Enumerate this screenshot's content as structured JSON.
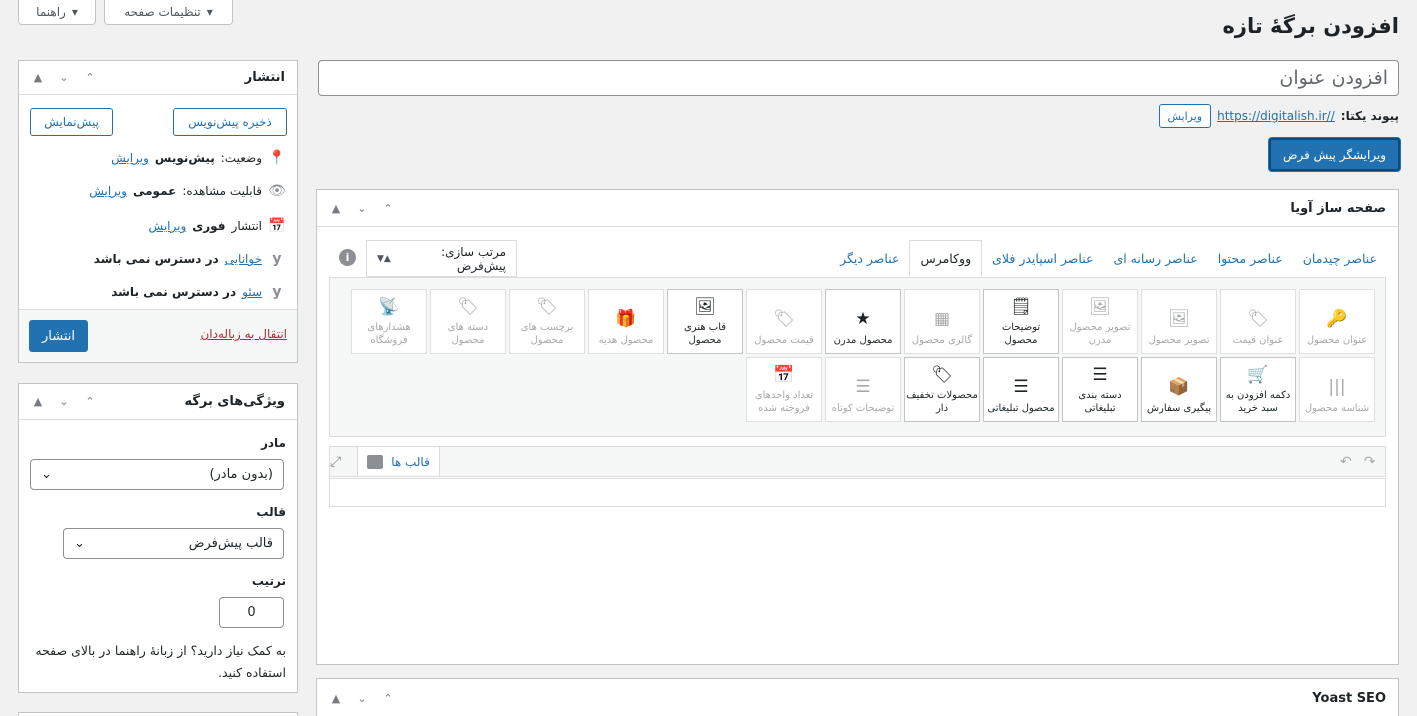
{
  "top": {
    "page_options": "تنظیمات صفحه",
    "help": "راهنما"
  },
  "page_title": "افزودن برگهٔ تازه",
  "title_placeholder": "افزودن عنوان",
  "permalink": {
    "label": "پیوند یکتا:",
    "url": "https://digitalish.ir//",
    "edit": "ویرایش"
  },
  "default_editor_button": "ویرایشگر پیش فرض",
  "builder": {
    "title": "صفحه ساز آویا",
    "tabs": [
      "عناصر چیدمان",
      "عناصر محتوا",
      "عناصر رسانه ای",
      "عناصر اسپایدر فلای",
      "ووکامرس",
      "عناصر دیگر"
    ],
    "active_tab": "ووکامرس",
    "sort_select": "مرتب سازی: پیش‌فرض",
    "row1": [
      {
        "label": "عنوان محصول",
        "icon": "🔑",
        "active": false
      },
      {
        "label": "عنوان قیمت",
        "icon": "🏷",
        "active": false
      },
      {
        "label": "تصویر محصول",
        "icon": "🖼",
        "active": false
      },
      {
        "label": "تصویر محصول مدرن",
        "icon": "🖼",
        "active": false
      },
      {
        "label": "توضیحات محصول",
        "icon": "🗒",
        "active": true
      },
      {
        "label": "گالری محصول",
        "icon": "▦",
        "active": false
      },
      {
        "label": "محصول مدرن",
        "icon": "★",
        "active": true
      },
      {
        "label": "قیمت محصول",
        "icon": "🏷",
        "active": false
      },
      {
        "label": "قاب هنری محصول",
        "icon": "🖼",
        "active": true
      },
      {
        "label": "محصول هدیه",
        "icon": "🎁",
        "active": false
      },
      {
        "label": "برچسب های محصول",
        "icon": "🏷",
        "active": false
      },
      {
        "label": "دسته های محصول",
        "icon": "🏷",
        "active": false
      },
      {
        "label": "هشدارهای فروشگاه",
        "icon": "📡",
        "active": false
      }
    ],
    "row2": [
      {
        "label": "شناسه محصول",
        "icon": "|||",
        "active": false
      },
      {
        "label": "دکمه افزودن به سبد خرید",
        "icon": "🛒",
        "active": true
      },
      {
        "label": "پیگیری سفارش",
        "icon": "📦",
        "active": true
      },
      {
        "label": "دسته بندی تبلیغاتی",
        "icon": "☰",
        "active": true
      },
      {
        "label": "محصول تبلیغاتی",
        "icon": "☰",
        "active": true
      },
      {
        "label": "محصولات تخفیف دار",
        "icon": "🏷",
        "active": true
      },
      {
        "label": "توضیحات کوتاه",
        "icon": "☰",
        "active": false
      },
      {
        "label": "تعداد واحدهای فروخته شده",
        "icon": "📅",
        "active": false
      }
    ],
    "templates": "قالب ها"
  },
  "yoast": {
    "title": "Yoast SEO"
  },
  "publish": {
    "title": "انتشار",
    "save_draft": "ذخیره پیش‌نویس",
    "preview": "پیش‌نمایش",
    "status_label": "وضعیت:",
    "status_value": "پیش‌نویس",
    "visibility_label": "قابلیت مشاهده:",
    "visibility_value": "عمومی",
    "publish_label": "انتشار",
    "publish_value": "فوری",
    "edit": "ویرایش",
    "readability_label": "خوانایی",
    "readability_value": "در دسترس نمی باشد",
    "seo_label": "سئو",
    "seo_value": "در دسترس نمی باشد",
    "trash": "انتقال به زباله‌دان",
    "publish_button": "انتشار"
  },
  "attributes": {
    "title": "ویژگی‌های برگه",
    "parent_label": "مادر",
    "parent_value": "(بدون مادر)",
    "template_label": "قالب",
    "template_value": "قالب پیش‌فرض",
    "order_label": "ترتیب",
    "order_value": "0",
    "help_text": "به کمک نیاز دارید؟ از زبانهٔ راهنما در بالای صفحه استفاده کنید."
  }
}
